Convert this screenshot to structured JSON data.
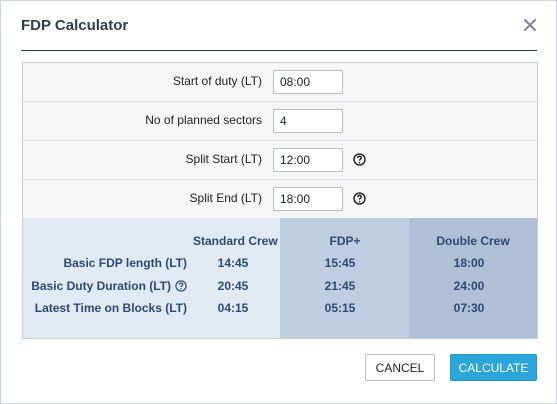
{
  "dialog": {
    "title": "FDP Calculator"
  },
  "form": {
    "rows": [
      {
        "label": "Start of duty  (LT)",
        "value": "08:00",
        "help": false
      },
      {
        "label": "No of planned sectors",
        "value": "4",
        "help": false
      },
      {
        "label": "Split Start  (LT)",
        "value": "12:00",
        "help": true,
        "help_icon": "question-circle-icon"
      },
      {
        "label": "Split End  (LT)",
        "value": "18:00",
        "help": true,
        "help_icon": "question-circle-icon"
      }
    ]
  },
  "results": {
    "columns": [
      "Standard Crew",
      "FDP+",
      "Double Crew"
    ],
    "rows": [
      {
        "label": "Basic FDP length  (LT)",
        "values": [
          "14:45",
          "15:45",
          "18:00"
        ],
        "help": false
      },
      {
        "label": "Basic Duty Duration  (LT)",
        "values": [
          "20:45",
          "21:45",
          "24:00"
        ],
        "help": true,
        "help_icon": "question-circle-icon"
      },
      {
        "label": "Latest Time on Blocks  (LT)",
        "values": [
          "04:15",
          "05:15",
          "07:30"
        ],
        "help": false
      }
    ]
  },
  "buttons": {
    "cancel": "CANCEL",
    "calculate": "CALCULATE"
  },
  "icons": {
    "close": "close-icon",
    "help": "question-circle-icon"
  },
  "colors": {
    "title": "#2d3e52",
    "results_text": "#2d4a72",
    "results_bg": "#e1e9f3",
    "fdp_plus_bg": "#bfcde0",
    "double_crew_bg": "#aebfd6",
    "primary_button": "#2aa6d9"
  }
}
